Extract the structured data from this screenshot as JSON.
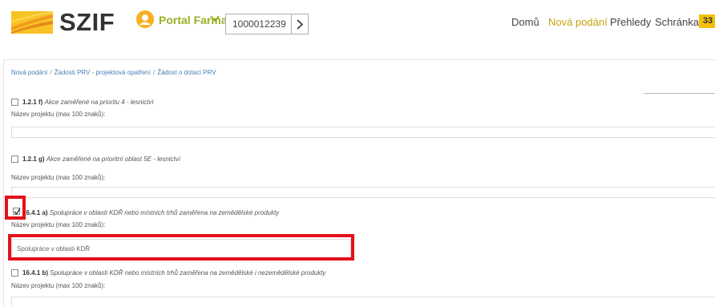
{
  "header": {
    "logo_text": "SZIF",
    "portal_label": "Portal Farmare",
    "id_value": "1000012239",
    "nav": [
      {
        "label": "Domů",
        "active": false
      },
      {
        "label": "Nová podání",
        "active": true
      },
      {
        "label": "Přehledy",
        "active": false
      },
      {
        "label": "Schránka",
        "active": false
      }
    ],
    "badge_count": "33",
    "colors": {
      "brand_yellow": "#f6b021",
      "portal_green": "#9ab026",
      "nav_active": "#c8a20e",
      "badge": "#f2c00c"
    }
  },
  "breadcrumb": {
    "items": [
      "Nová podání",
      "Žádosti PRV - projektová opatření",
      "Žádost o dotaci PRV"
    ],
    "separator": "/"
  },
  "options": [
    {
      "code": "1.2.1 f)",
      "description": "Akce zaměřené na prioritu 4 - lesnictví",
      "checked": false,
      "field_label": "Název projektu (max 100 znaků):",
      "field_value": ""
    },
    {
      "code": "1.2.1 g)",
      "description": "Akce zaměřené na prioritní oblast 5E - lesnictví",
      "checked": false,
      "field_label": "Název projektu (max 100 znaků):",
      "field_value": ""
    },
    {
      "code": "16.4.1 a)",
      "description": "Spolupráce v oblasti KDŘ nebo místních trhů zaměřena na zemědělské produkty",
      "checked": true,
      "field_label": "Název projektu (max 100 znaků):",
      "field_value": "Spolupráce v oblasti KDŘ"
    },
    {
      "code": "16.4.1 b)",
      "description": "Spolupráce v oblasti KDŘ nebo místních trhů zaměřena na zemědělské i nezemědělské produkty",
      "checked": false,
      "field_label": "Název projektu (max 100 znaků):",
      "field_value": ""
    }
  ],
  "highlight_color": "#e4101a"
}
